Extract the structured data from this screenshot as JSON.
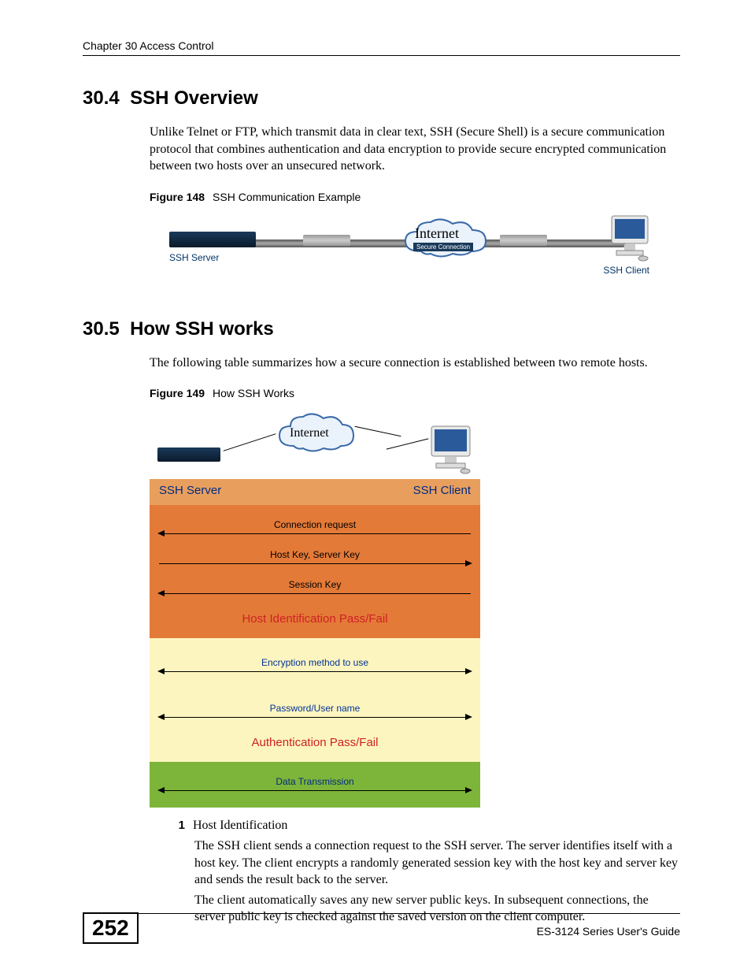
{
  "chapterHeader": "Chapter 30 Access Control",
  "section1": {
    "number": "30.4",
    "title": "SSH Overview",
    "para": "Unlike Telnet or FTP, which transmit data in clear text, SSH (Secure Shell) is a secure communication protocol that combines authentication and data encryption to provide secure encrypted communication between two hosts over an unsecured network."
  },
  "fig148": {
    "labelNum": "Figure 148",
    "labelText": "SSH Communication Example",
    "sshServer": "SSH Server",
    "internet": "Internet",
    "secureConn": "Secure Connection",
    "sshClient": "SSH Client"
  },
  "section2": {
    "number": "30.5",
    "title": "How SSH works",
    "para": "The following table summarizes how a secure connection is established between two remote hosts."
  },
  "fig149": {
    "labelNum": "Figure 149",
    "labelText": "How SSH Works",
    "internet": "Internet",
    "sshServer": "SSH Server",
    "sshClient": "SSH Client",
    "connReq": "Connection request",
    "hostKey": "Host Key, Server Key",
    "sessionKey": "Session Key",
    "hostIdPassFail": "Host Identification Pass/Fail",
    "encryption": "Encryption method to use",
    "password": "Password/User name",
    "authPassFail": "Authentication Pass/Fail",
    "dataTrans": "Data Transmission"
  },
  "list": {
    "num": "1",
    "title": "Host Identification",
    "p1": "The SSH client sends a connection request to the SSH server. The server identifies itself with a host key. The client encrypts a randomly generated session key with the host key and server key and sends the result back to the server.",
    "p2": "The client automatically saves any new server public keys. In subsequent connections, the server public key is checked against the saved version on the client computer."
  },
  "footer": {
    "pageNum": "252",
    "guide": "ES-3124 Series User's Guide"
  }
}
